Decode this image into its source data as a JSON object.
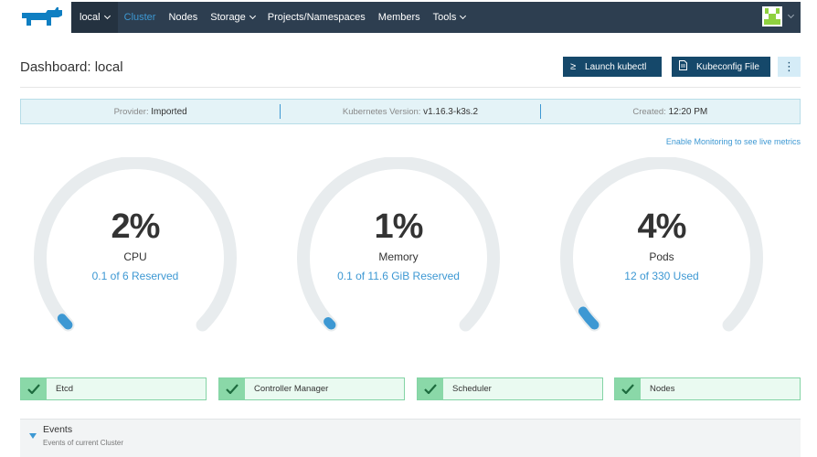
{
  "nav": {
    "items": [
      {
        "label": "local",
        "dropdown": true
      },
      {
        "label": "Cluster",
        "dropdown": false
      },
      {
        "label": "Nodes",
        "dropdown": false
      },
      {
        "label": "Storage",
        "dropdown": true
      },
      {
        "label": "Projects/Namespaces",
        "dropdown": false
      },
      {
        "label": "Members",
        "dropdown": false
      },
      {
        "label": "Tools",
        "dropdown": true
      }
    ],
    "logo_icon": "rancher-cow-logo-icon",
    "avatar_icon": "user-avatar-icon"
  },
  "header": {
    "title": "Dashboard: local",
    "kubectl_label": "Launch kubectl",
    "kubectl_icon": "≥",
    "kubeconfig_label": "Kubeconfig File",
    "kubeconfig_icon": "file-icon",
    "more_icon": "⋮"
  },
  "info": {
    "provider_label": "Provider:",
    "provider_value": "Imported",
    "version_label": "Kubernetes Version:",
    "version_value": "v1.16.3-k3s.2",
    "created_label": "Created:",
    "created_value": "12:20 PM"
  },
  "monitoring_link": "Enable Monitoring to see live metrics",
  "gauges": [
    {
      "value": "2%",
      "name": "CPU",
      "detail": "0.1 of 6 Reserved",
      "fraction": 0.02
    },
    {
      "value": "1%",
      "name": "Memory",
      "detail": "0.1 of 11.6 GiB Reserved",
      "fraction": 0.01
    },
    {
      "value": "4%",
      "name": "Pods",
      "detail": "12 of 330 Used",
      "fraction": 0.04
    }
  ],
  "components": [
    {
      "label": "Etcd"
    },
    {
      "label": "Controller Manager"
    },
    {
      "label": "Scheduler"
    },
    {
      "label": "Nodes"
    }
  ],
  "events": {
    "title": "Events",
    "subtitle": "Events of current Cluster"
  },
  "colors": {
    "nav_bg": "#2d3e50",
    "accent": "#3d98d3",
    "button": "#15486a",
    "success": "#8ad8a8"
  }
}
